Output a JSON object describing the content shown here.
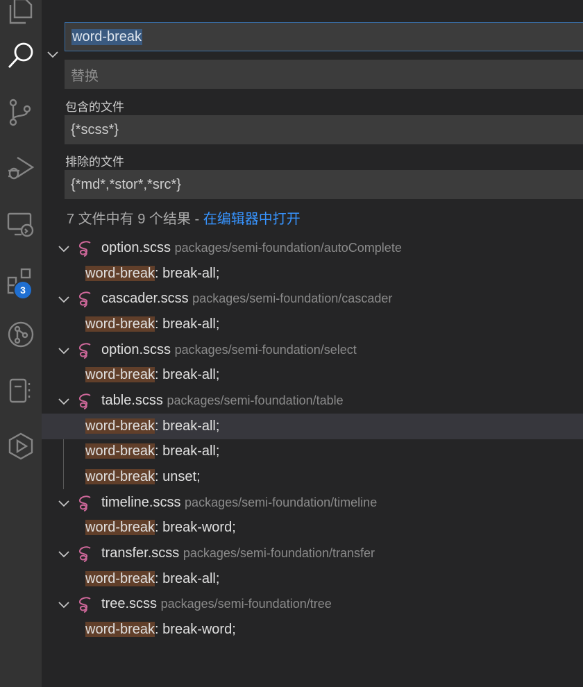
{
  "activity_bar": {
    "items": [
      {
        "name": "explorer-icon"
      },
      {
        "name": "search-icon"
      },
      {
        "name": "source-control-icon"
      },
      {
        "name": "run-debug-icon"
      },
      {
        "name": "remote-explorer-icon"
      },
      {
        "name": "extensions-icon"
      },
      {
        "name": "git-graph-icon"
      },
      {
        "name": "notebook-icon"
      },
      {
        "name": "live-share-icon"
      }
    ],
    "extensions_badge": "3"
  },
  "search": {
    "query": "word-break",
    "replace_placeholder": "替换",
    "include_label": "包含的文件",
    "include_value": "{*scss*}",
    "exclude_label": "排除的文件",
    "exclude_value": "{*md*,*stor*,*src*}",
    "summary_text": "7 文件中有 9 个结果 - ",
    "summary_link": "在编辑器中打开"
  },
  "results": [
    {
      "file": "option.scss",
      "path": "packages/semi-foundation/autoComplete",
      "matches": [
        {
          "hit": "word-break",
          "rest": ": break-all;"
        }
      ]
    },
    {
      "file": "cascader.scss",
      "path": "packages/semi-foundation/cascader",
      "matches": [
        {
          "hit": "word-break",
          "rest": ": break-all;"
        }
      ]
    },
    {
      "file": "option.scss",
      "path": "packages/semi-foundation/select",
      "matches": [
        {
          "hit": "word-break",
          "rest": ": break-all;"
        }
      ]
    },
    {
      "file": "table.scss",
      "path": "packages/semi-foundation/table",
      "matches": [
        {
          "hit": "word-break",
          "rest": ": break-all;"
        },
        {
          "hit": "word-break",
          "rest": ": break-all;"
        },
        {
          "hit": "word-break",
          "rest": ": unset;"
        }
      ]
    },
    {
      "file": "timeline.scss",
      "path": "packages/semi-foundation/timeline",
      "matches": [
        {
          "hit": "word-break",
          "rest": ": break-word;"
        }
      ]
    },
    {
      "file": "transfer.scss",
      "path": "packages/semi-foundation/transfer",
      "matches": [
        {
          "hit": "word-break",
          "rest": ": break-all;"
        }
      ]
    },
    {
      "file": "tree.scss",
      "path": "packages/semi-foundation/tree",
      "matches": [
        {
          "hit": "word-break",
          "rest": ": break-word;"
        }
      ]
    }
  ],
  "colors": {
    "activity_bar": "#333333",
    "panel": "#252526",
    "input": "#3c3c3c",
    "link": "#3794ff",
    "match_highlight": "#613f2a",
    "sass_icon": "#cd6799",
    "badge": "#1f6fd1"
  }
}
